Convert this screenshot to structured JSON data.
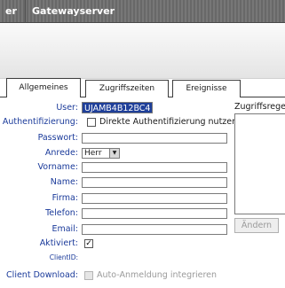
{
  "header": {
    "title_left_fragment": "er",
    "title": "Gatewayserver"
  },
  "tabs": [
    {
      "label": "Allgemeines",
      "active": true
    },
    {
      "label": "Zugriffszeiten",
      "active": false
    },
    {
      "label": "Ereignisse",
      "active": false
    }
  ],
  "form": {
    "user_label": "User:",
    "user_value": "UJAMB4B12BC4",
    "auth_label": "Authentifizierung:",
    "auth_checkbox_label": "Direkte Authentifizierung nutzen",
    "auth_checked": false,
    "password_label": "Passwort:",
    "salutation_label": "Anrede:",
    "salutation_value": "Herr",
    "firstname_label": "Vorname:",
    "lastname_label": "Name:",
    "company_label": "Firma:",
    "phone_label": "Telefon:",
    "email_label": "Email:",
    "activated_label": "Aktiviert:",
    "activated_checked": true,
    "clientid_label": "ClientID:",
    "client_download_label": "Client Download:",
    "auto_login_label": "Auto-Anmeldung integrieren",
    "auto_login_enabled": false
  },
  "access_rules": {
    "title": "Zugriffsregeln",
    "change_button": "Ändern"
  },
  "colors": {
    "label_blue": "#1a3a9a",
    "selection_blue": "#1f3f99",
    "titlebar": "#6f6f6f"
  }
}
